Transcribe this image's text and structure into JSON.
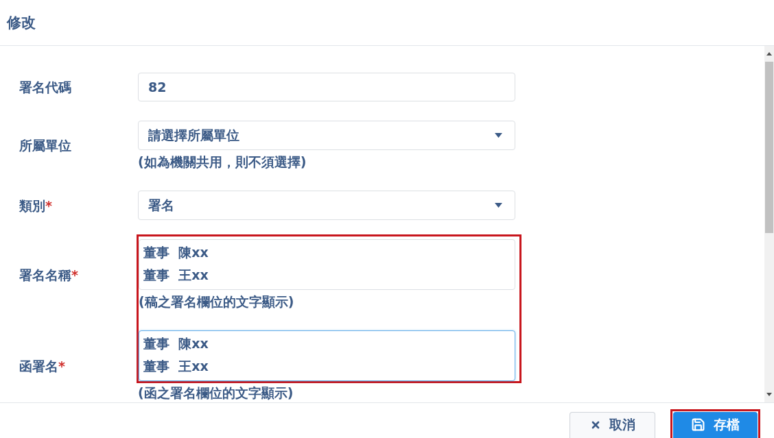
{
  "dialog": {
    "title": "修改"
  },
  "form": {
    "fields": [
      {
        "kind": "input",
        "label": "署名代碼",
        "value": "82",
        "focused": false,
        "highlighted": false
      },
      {
        "kind": "select",
        "label": "所屬單位",
        "value": "請選擇所屬單位",
        "help": "(如為機關共用，則不須選擇)",
        "focused": false,
        "highlighted": false
      },
      {
        "kind": "select",
        "label": "類別",
        "required_mark": "*",
        "value": "署名",
        "focused": false,
        "highlighted": false
      },
      {
        "kind": "textarea",
        "label": "署名名稱",
        "required_mark": "*",
        "value": "董事  陳xx\n董事  王xx",
        "help": "(稿之署名欄位的文字顯示)",
        "focused": false,
        "highlighted": true
      },
      {
        "kind": "textarea",
        "label": "函署名",
        "required_mark": "*",
        "value": "董事  陳xx\n董事  王xx",
        "help": "(函之署名欄位的文字顯示)",
        "focused": true,
        "highlighted": true
      }
    ]
  },
  "footer": {
    "buttons": [
      {
        "kind": "cancel",
        "label": "取消",
        "highlighted": false
      },
      {
        "kind": "save",
        "label": "存檔",
        "highlighted": true
      }
    ]
  }
}
